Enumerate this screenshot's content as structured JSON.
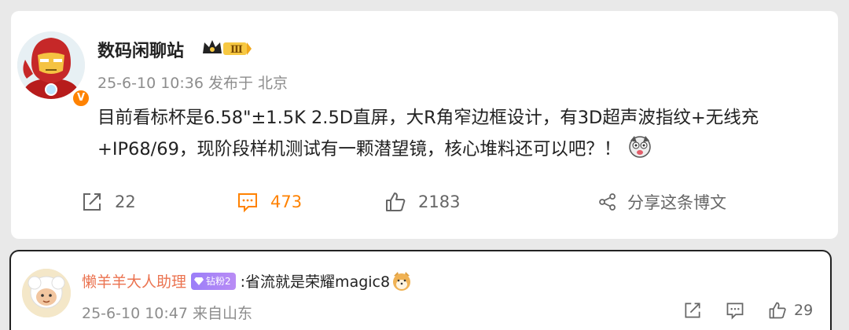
{
  "post": {
    "author": {
      "name": "数码闲聊站",
      "verified_icon": "V",
      "level_badge": "Ⅲ"
    },
    "time": "25-6-10 10:36",
    "source": "发布于 北京",
    "text": "目前看标杯是6.58\"±1.5K 2.5D直屏，大R角窄边框设计，有3D超声波指纹+无线充+IP68/69，现阶段样机测试有一颗潜望镜，核心堆料还可以吧？！",
    "actions": {
      "repost_count": "22",
      "comment_count": "473",
      "like_count": "2183",
      "share_label": "分享这条博文"
    }
  },
  "comment": {
    "author": "懒羊羊大人助理",
    "fan_badge": "钻粉2",
    "text": ":省流就是荣耀magic8",
    "time": "25-6-10 10:47",
    "source": "来自山东",
    "like_count": "29"
  },
  "colors": {
    "accent": "#ff8200",
    "commenter_name": "#eb7350",
    "muted": "#8d8d8d"
  }
}
